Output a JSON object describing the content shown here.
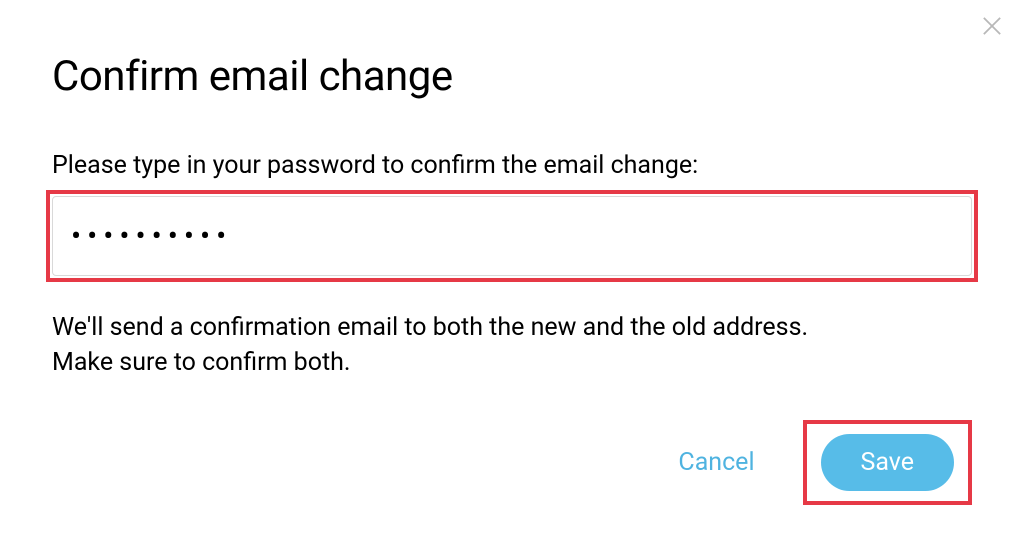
{
  "dialog": {
    "title": "Confirm email change",
    "prompt": "Please type in your password to confirm the email change:",
    "password_value": "••••••••••",
    "info": "We'll send a confirmation email to both the new and the old address. Make sure to confirm both.",
    "cancel_label": "Cancel",
    "save_label": "Save"
  }
}
